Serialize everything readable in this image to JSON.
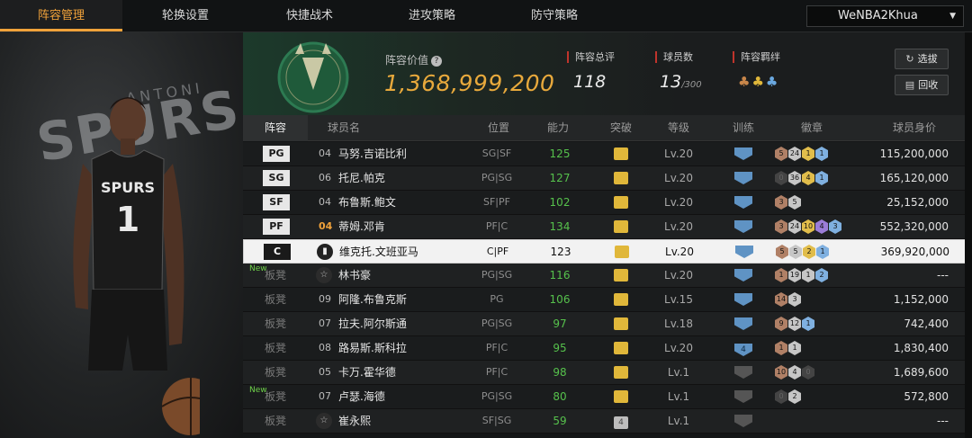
{
  "nav": {
    "tabs": [
      {
        "label": "阵容管理",
        "active": true
      },
      {
        "label": "轮换设置",
        "active": false
      },
      {
        "label": "快捷战术",
        "active": false
      },
      {
        "label": "进攻策略",
        "active": false
      },
      {
        "label": "防守策略",
        "active": false
      }
    ],
    "user_select": "WeNBA2Khua"
  },
  "team": {
    "value_label": "阵容价值",
    "value": "1,368,999,200",
    "overall_label": "阵容总评",
    "overall": "118",
    "count_label": "球员数",
    "count": "13",
    "count_max": "/300",
    "chem_label": "阵容羁绊",
    "art_text": "SPURS",
    "art_text2": "ANTONI",
    "jersey_number": "1",
    "jersey_team": "SPURS"
  },
  "buttons": {
    "draft": "选拔",
    "return": "回收"
  },
  "table": {
    "headers": [
      "阵容",
      "球员名",
      "位置",
      "能力",
      "突破",
      "等级",
      "训练",
      "徽章",
      "球员身价"
    ],
    "rows": [
      {
        "slot": "PG",
        "bench": false,
        "new": false,
        "num": "04",
        "num_gold": false,
        "icon": "",
        "name": "马努.吉诺比利",
        "pos": "SG|SF",
        "ovr": "125",
        "brk": "",
        "brk_grey": false,
        "lvl": "Lv.20",
        "train": "",
        "train_grey": false,
        "badges": [
          {
            "t": "bronze",
            "v": "5"
          },
          {
            "t": "silver",
            "v": "24"
          },
          {
            "t": "gold",
            "v": "1"
          },
          {
            "t": "blue",
            "v": "1"
          }
        ],
        "salary": "115,200,000"
      },
      {
        "slot": "SG",
        "bench": false,
        "new": false,
        "num": "06",
        "num_gold": false,
        "icon": "",
        "name": "托尼.帕克",
        "pos": "PG|SG",
        "ovr": "127",
        "brk": "",
        "brk_grey": false,
        "lvl": "Lv.20",
        "train": "",
        "train_grey": false,
        "badges": [
          {
            "t": "dim",
            "v": "0"
          },
          {
            "t": "silver",
            "v": "36"
          },
          {
            "t": "gold",
            "v": "4"
          },
          {
            "t": "blue",
            "v": "1"
          }
        ],
        "salary": "165,120,000"
      },
      {
        "slot": "SF",
        "bench": false,
        "new": false,
        "num": "04",
        "num_gold": false,
        "icon": "",
        "name": "布鲁斯.鲍文",
        "pos": "SF|PF",
        "ovr": "102",
        "brk": "",
        "brk_grey": false,
        "lvl": "Lv.20",
        "train": "",
        "train_grey": false,
        "badges": [
          {
            "t": "bronze",
            "v": "3"
          },
          {
            "t": "silver",
            "v": "5"
          }
        ],
        "salary": "25,152,000"
      },
      {
        "slot": "PF",
        "bench": false,
        "new": false,
        "num": "04",
        "num_gold": true,
        "icon": "",
        "name": "蒂姆.邓肯",
        "pos": "PF|C",
        "ovr": "134",
        "brk": "",
        "brk_grey": false,
        "lvl": "Lv.20",
        "train": "",
        "train_grey": false,
        "badges": [
          {
            "t": "bronze",
            "v": "3"
          },
          {
            "t": "silver",
            "v": "24"
          },
          {
            "t": "gold",
            "v": "10"
          },
          {
            "t": "purple",
            "v": "4"
          },
          {
            "t": "blue",
            "v": "3"
          }
        ],
        "salary": "552,320,000"
      },
      {
        "slot": "C",
        "bench": false,
        "new": false,
        "num": "",
        "num_gold": false,
        "icon": "bars",
        "name": "维克托.文班亚马",
        "pos": "C|PF",
        "ovr": "123",
        "brk": "",
        "brk_grey": false,
        "lvl": "Lv.20",
        "train": "",
        "train_grey": false,
        "badges": [
          {
            "t": "bronze",
            "v": "5"
          },
          {
            "t": "silver",
            "v": "5"
          },
          {
            "t": "gold",
            "v": "2"
          },
          {
            "t": "blue",
            "v": "1"
          }
        ],
        "salary": "369,920,000"
      },
      {
        "slot": "板凳",
        "bench": true,
        "new": true,
        "new_label": "New",
        "num": "",
        "num_gold": false,
        "icon": "star",
        "name": "林书豪",
        "pos": "PG|SG",
        "ovr": "116",
        "brk": "",
        "brk_grey": false,
        "lvl": "Lv.20",
        "train": "",
        "train_grey": false,
        "badges": [
          {
            "t": "bronze",
            "v": "1"
          },
          {
            "t": "silver",
            "v": "19"
          },
          {
            "t": "silver",
            "v": "1"
          },
          {
            "t": "blue",
            "v": "2"
          }
        ],
        "salary": "---"
      },
      {
        "slot": "板凳",
        "bench": true,
        "new": false,
        "num": "09",
        "num_gold": false,
        "icon": "",
        "name": "阿隆.布鲁克斯",
        "pos": "PG",
        "ovr": "106",
        "brk": "",
        "brk_grey": false,
        "lvl": "Lv.15",
        "train": "",
        "train_grey": false,
        "badges": [
          {
            "t": "bronze",
            "v": "14"
          },
          {
            "t": "silver",
            "v": "3"
          }
        ],
        "salary": "1,152,000"
      },
      {
        "slot": "板凳",
        "bench": true,
        "new": false,
        "num": "07",
        "num_gold": false,
        "icon": "",
        "name": "拉夫.阿尔斯通",
        "pos": "PG|SG",
        "ovr": "97",
        "brk": "",
        "brk_grey": false,
        "lvl": "Lv.18",
        "train": "",
        "train_grey": false,
        "badges": [
          {
            "t": "bronze",
            "v": "9"
          },
          {
            "t": "silver",
            "v": "12"
          },
          {
            "t": "blue",
            "v": "1"
          }
        ],
        "salary": "742,400"
      },
      {
        "slot": "板凳",
        "bench": true,
        "new": false,
        "num": "08",
        "num_gold": false,
        "icon": "",
        "name": "路易斯.斯科拉",
        "pos": "PF|C",
        "ovr": "95",
        "brk": "",
        "brk_grey": false,
        "lvl": "Lv.20",
        "train": "4",
        "train_grey": false,
        "badges": [
          {
            "t": "bronze",
            "v": "1"
          },
          {
            "t": "silver",
            "v": "1"
          }
        ],
        "salary": "1,830,400"
      },
      {
        "slot": "板凳",
        "bench": true,
        "new": false,
        "num": "05",
        "num_gold": false,
        "icon": "",
        "name": "卡万.霍华德",
        "pos": "PF|C",
        "ovr": "98",
        "brk": "",
        "brk_grey": false,
        "lvl": "Lv.1",
        "train": "",
        "train_grey": true,
        "badges": [
          {
            "t": "bronze",
            "v": "10"
          },
          {
            "t": "silver",
            "v": "4"
          },
          {
            "t": "dim",
            "v": "0"
          }
        ],
        "salary": "1,689,600"
      },
      {
        "slot": "板凳",
        "bench": true,
        "new": true,
        "new_label": "New",
        "num": "07",
        "num_gold": false,
        "icon": "",
        "name": "卢瑟.海德",
        "pos": "PG|SG",
        "ovr": "80",
        "brk": "",
        "brk_grey": false,
        "lvl": "Lv.1",
        "train": "",
        "train_grey": true,
        "badges": [
          {
            "t": "dim",
            "v": "0"
          },
          {
            "t": "silver",
            "v": "2"
          }
        ],
        "salary": "572,800"
      },
      {
        "slot": "板凳",
        "bench": true,
        "new": false,
        "num": "",
        "num_gold": false,
        "icon": "star",
        "name": "崔永熙",
        "pos": "SF|SG",
        "ovr": "59",
        "brk": "4",
        "brk_grey": true,
        "lvl": "Lv.1",
        "train": "",
        "train_grey": true,
        "badges": [],
        "salary": "---"
      }
    ]
  },
  "colors": {
    "accent": "#f0a23a",
    "ovr_green": "#56c14c",
    "stat_red": "#c0342c"
  }
}
